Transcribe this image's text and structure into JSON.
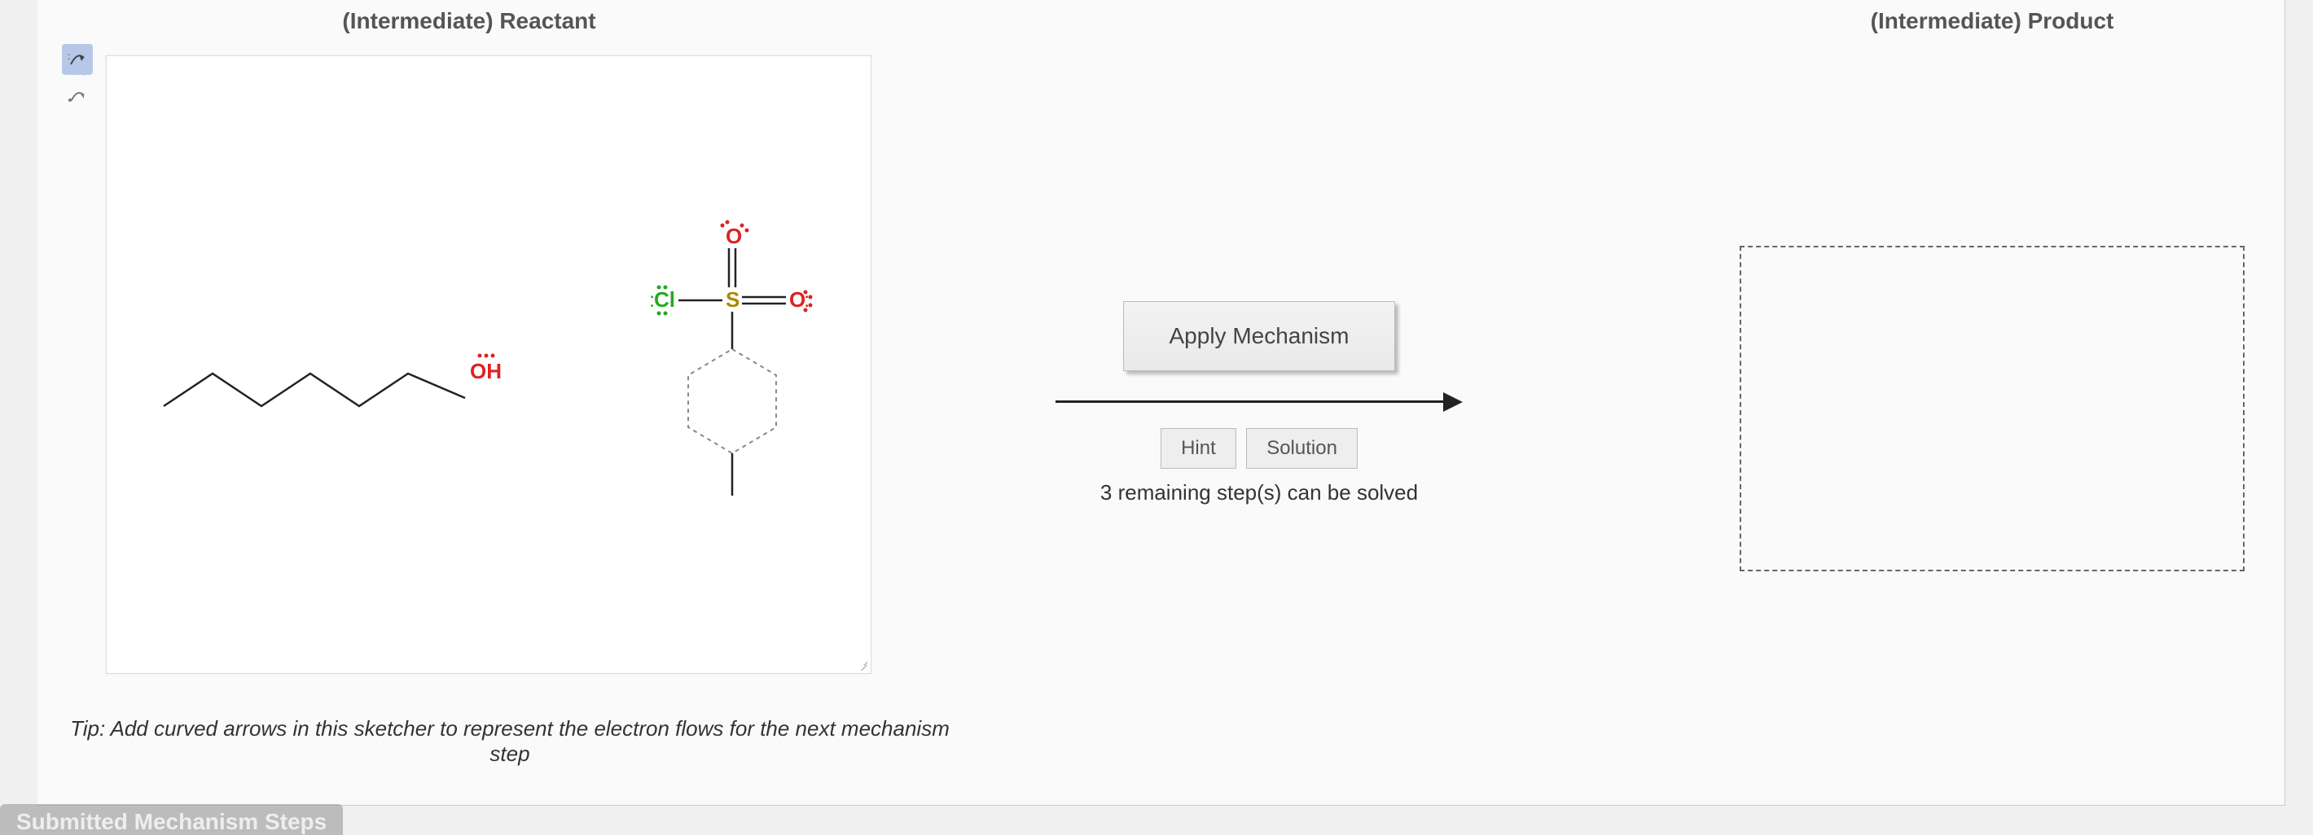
{
  "left": {
    "title": "(Intermediate) Reactant",
    "tip": "Tip: Add curved arrows in this sketcher to represent the electron flows for the next mechanism step",
    "toolbar_top": [
      {
        "name": "marquee-select-icon"
      },
      {
        "name": "eraser-icon"
      },
      {
        "name": "undo-icon"
      },
      {
        "name": "redo-icon"
      },
      {
        "name": "cut-icon"
      },
      {
        "name": "copy-icon"
      },
      {
        "name": "paste-icon"
      },
      {
        "name": "zoom-reset-icon"
      },
      {
        "name": "zoom-in-icon"
      },
      {
        "name": "zoom-out-icon"
      },
      {
        "name": "zoom-fit-icon"
      }
    ],
    "toolbar_side": [
      {
        "name": "electron-pair-arrow-tool",
        "selected": true
      },
      {
        "name": "single-electron-arrow-tool",
        "selected": false
      }
    ],
    "molecule": {
      "alcohol_label": "OH",
      "sulfonyl": {
        "Cl": "Cl",
        "S": "S",
        "O1": "O",
        "O2": "O"
      }
    }
  },
  "middle": {
    "apply_label": "Apply Mechanism",
    "hint_label": "Hint",
    "solution_label": "Solution",
    "remaining_text": "3 remaining step(s) can be solved"
  },
  "right": {
    "title": "(Intermediate) Product"
  },
  "footer_tab": "Submitted Mechanism Steps"
}
